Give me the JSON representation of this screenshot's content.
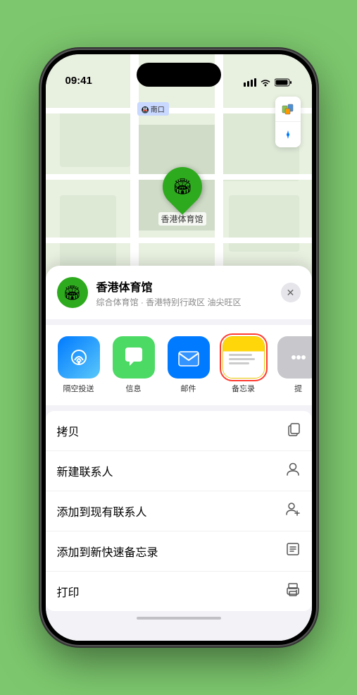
{
  "device": {
    "time": "09:41",
    "location_arrow": "▶"
  },
  "map": {
    "label_south": "南口"
  },
  "controls": {
    "map_icon": "🗺",
    "compass_icon": "⊕"
  },
  "pin": {
    "name": "香港体育馆",
    "emoji": "🏟"
  },
  "location_header": {
    "name": "香港体育馆",
    "subtitle": "综合体育馆 · 香港特别行政区 油尖旺区",
    "close": "✕"
  },
  "share_actions": [
    {
      "id": "airdrop",
      "label": "隔空投送",
      "type": "airdrop"
    },
    {
      "id": "message",
      "label": "信息",
      "type": "message"
    },
    {
      "id": "mail",
      "label": "邮件",
      "type": "mail"
    },
    {
      "id": "notes",
      "label": "备忘录",
      "type": "notes",
      "selected": true
    },
    {
      "id": "more",
      "label": "提",
      "type": "more"
    }
  ],
  "menu_items": [
    {
      "label": "拷贝",
      "icon": "copy"
    },
    {
      "label": "新建联系人",
      "icon": "person"
    },
    {
      "label": "添加到现有联系人",
      "icon": "person-add"
    },
    {
      "label": "添加到新快速备忘录",
      "icon": "note"
    },
    {
      "label": "打印",
      "icon": "print"
    }
  ]
}
